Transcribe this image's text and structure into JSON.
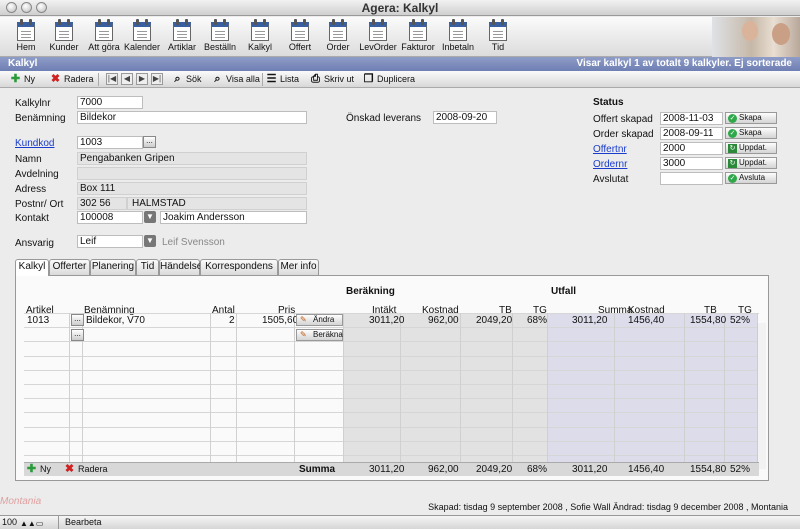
{
  "window": {
    "title": "Agera: Kalkyl"
  },
  "toolbar": [
    {
      "name": "hem",
      "label": "Hem"
    },
    {
      "name": "kunder",
      "label": "Kunder"
    },
    {
      "name": "att-gora",
      "label": "Att göra"
    },
    {
      "name": "kalender",
      "label": "Kalender"
    },
    {
      "name": "artiklar",
      "label": "Artiklar"
    },
    {
      "name": "bestalln",
      "label": "Beställn"
    },
    {
      "name": "kalkyl",
      "label": "Kalkyl"
    },
    {
      "name": "offert",
      "label": "Offert"
    },
    {
      "name": "order",
      "label": "Order"
    },
    {
      "name": "levorder",
      "label": "LevOrder"
    },
    {
      "name": "fakturor",
      "label": "Fakturor"
    },
    {
      "name": "inbetaln",
      "label": "Inbetaln"
    },
    {
      "name": "tid",
      "label": "Tid"
    }
  ],
  "header": {
    "title": "Kalkyl",
    "info": "Visar kalkyl 1 av totalt 9 kalkyler. Ej sorterade"
  },
  "actions": {
    "ny": "Ny",
    "radera": "Radera",
    "sok": "Sök",
    "visa_alla": "Visa alla",
    "lista": "Lista",
    "skriv_ut": "Skriv ut",
    "duplicera": "Duplicera"
  },
  "form": {
    "kalkylnr_label": "Kalkylnr",
    "kalkylnr": "7000",
    "benamning_label": "Benämning",
    "benamning": "Bildekor",
    "onskad_label": "Önskad leverans",
    "onskad": "2008-09-20",
    "kundkod_label": "Kundkod",
    "kundkod": "1003",
    "namn_label": "Namn",
    "namn": "Pengabanken Gripen",
    "avdelning_label": "Avdelning",
    "avdelning": "",
    "adress_label": "Adress",
    "adress": "Box 111",
    "postnr_label": "Postnr/ Ort",
    "postnr": "302 56",
    "ort": "HALMSTAD",
    "kontakt_label": "Kontakt",
    "kontakt_id": "100008",
    "kontakt_name": "Joakim Andersson",
    "ansvarig_label": "Ansvarig",
    "ansvarig": "Leif",
    "ansvarig_name": "Leif Svensson"
  },
  "status": {
    "title": "Status",
    "offert_skapad_label": "Offert skapad",
    "offert_skapad": "2008-11-03",
    "skapa1": "Skapa",
    "order_skapad_label": "Order skapad",
    "order_skapad": "2008-09-11",
    "skapa2": "Skapa",
    "offertnr_label": "Offertnr",
    "offertnr": "2000",
    "uppdat1": "Uppdat.",
    "ordernr_label": "Ordernr",
    "ordernr": "3000",
    "uppdat2": "Uppdat.",
    "avslutat_label": "Avslutat",
    "avslutat": "",
    "avsluta": "Avsluta"
  },
  "tabs": [
    "Kalkyl",
    "Offerter",
    "Planering",
    "Tid",
    "Händelser",
    "Korrespondens",
    "Mer info"
  ],
  "grid": {
    "group_berakning": "Beräkning",
    "group_utfall": "Utfall",
    "headers": {
      "artikel": "Artikel",
      "benamning": "Benämning",
      "antal": "Antal",
      "pris": "Pris",
      "intakt": "Intäkt",
      "kostnad": "Kostnad",
      "tb": "TB",
      "tg": "TG",
      "summa": "Summa",
      "ukostnad": "Kostnad",
      "utb": "TB",
      "utg": "TG"
    },
    "row": {
      "artikel": "1013",
      "benamning": "Bildekor, V70",
      "antal": "2",
      "pris": "1505,60",
      "andra": "Ändra",
      "berakna": "Beräkna",
      "intakt": "3011,20",
      "kostnad": "962,00",
      "tb": "2049,20",
      "tg": "68%",
      "summa": "3011,20",
      "ukostnad": "1456,40",
      "utb": "1554,80",
      "utg": "52%"
    },
    "footer": {
      "ny": "Ny",
      "radera": "Radera",
      "summa_label": "Summa",
      "intakt": "3011,20",
      "kostnad": "962,00",
      "tb": "2049,20",
      "tg": "68%",
      "summa": "3011,20",
      "ukostnad": "1456,40",
      "utb": "1554,80",
      "utg": "52%"
    }
  },
  "footer": {
    "audit": "Skapad: tisdag 9 september 2008 , Sofie Wall Ändrad: tisdag 9 december 2008 , Montania"
  },
  "statusbar": {
    "zoom": "100",
    "mode": "Bearbeta"
  },
  "logo": "Montania"
}
